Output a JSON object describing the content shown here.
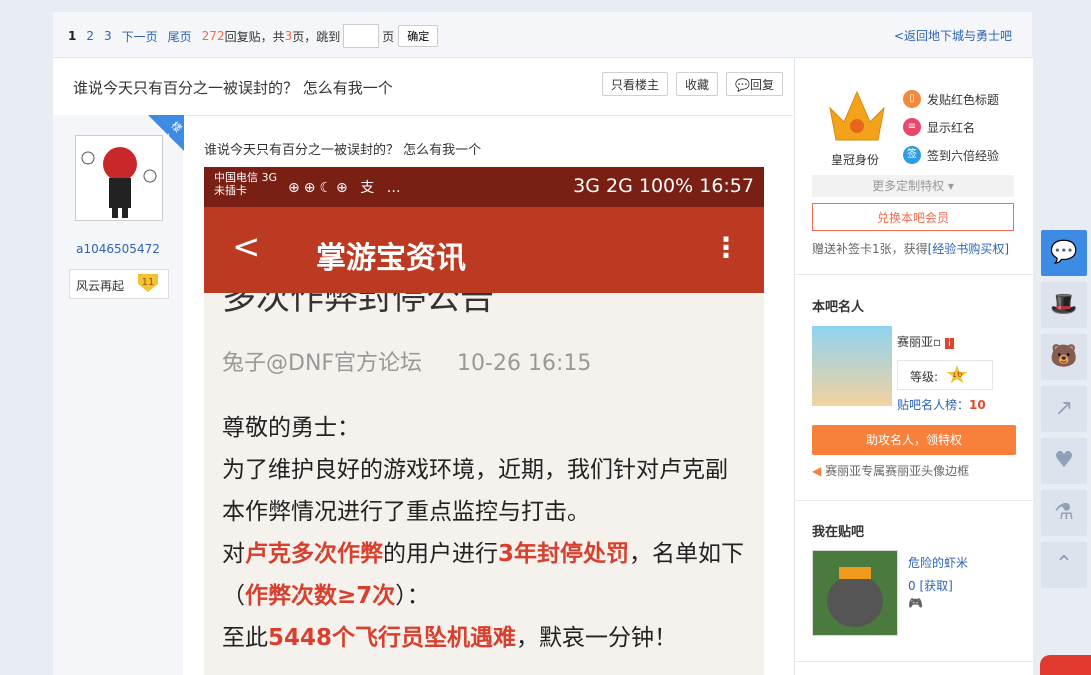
{
  "pager": {
    "pages": [
      "1",
      "2",
      "3"
    ],
    "next": "下一页",
    "last": "尾页",
    "reply_count": "272",
    "reply_suffix": "回复贴，共",
    "total_pages": "3",
    "pages_suffix": "页，跳到",
    "page_unit": "页",
    "confirm": "确定",
    "back_link": "<返回地下城与勇士吧"
  },
  "thread": {
    "title": "谁说今天只有百分之一被误封的？ 怎么有我一个",
    "btn_only_op": "只看楼主",
    "btn_favorite": "收藏",
    "btn_reply": "回复"
  },
  "author": {
    "badge": "楼主",
    "username": "a1046505472",
    "level_title": "风云再起",
    "level": "11"
  },
  "post": {
    "text": "谁说今天只有百分之一被误封的？ 怎么有我一个",
    "screenshot": {
      "carrier": "中国电信 3G",
      "sim": "未插卡",
      "status_icons": "⊕⊕☾⊕ 支 …",
      "status_right": "3G 2G  100%  16:57",
      "app_title": "掌游宝资讯",
      "back": "<",
      "more": "⋮",
      "headline": "多次作弊封停公告",
      "meta_author": "兔子@DNF官方论坛",
      "meta_time": "10-26 16:15",
      "p1": "尊敬的勇士：",
      "p2": "为了维护良好的游戏环境，近期，我们针对卢克副本作弊情况进行了重点监控与打击。",
      "p3a": "对",
      "p3b": "卢克多次作弊",
      "p3c": "的用户进行",
      "p3d": "3年封停处罚",
      "p3e": "，名单如下（",
      "p3f": "作弊次数≥7次",
      "p3g": "）：",
      "p4a": "至此",
      "p4b": "5448个飞行员坠机遇难",
      "p4c": "，默哀一分钟！"
    }
  },
  "sidebar": {
    "crown_label": "皇冠身份",
    "perks": [
      "发贴红色标题",
      "显示红名",
      "签到六倍经验"
    ],
    "more_custom": "更多定制特权 ▾",
    "exchange": "兑换本吧会员",
    "gift_text": "赠送补签卡1张，获得",
    "gift_link": "[经验书购买权]",
    "celeb_section": "本吧名人",
    "celeb_name": "赛丽亚▫",
    "celeb_level_label": "等级:",
    "celeb_level": "16",
    "celeb_rank_label": "贴吧名人榜：",
    "celeb_rank": "10",
    "celeb_btn": "助攻名人，领特权",
    "celeb_skin": "赛丽亚专属赛丽亚头像边框",
    "my_section": "我在贴吧",
    "my_name": "危险的虾米",
    "my_coin": "0 [获取]",
    "my_game": "🎮"
  },
  "colors": {
    "accent": "#3d8be3",
    "link": "#2d64b3",
    "red": "#f26c4f",
    "orange": "#f7803a"
  }
}
